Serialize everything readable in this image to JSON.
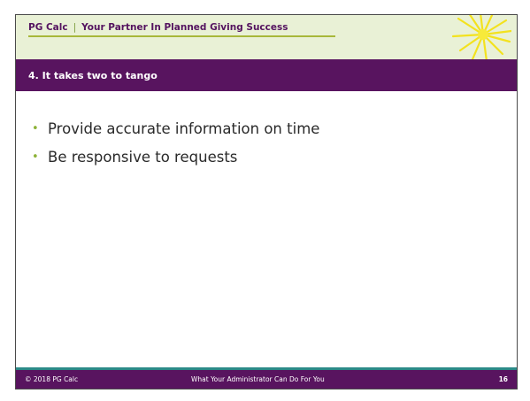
{
  "header": {
    "brand": "PG Calc",
    "separator": "|",
    "tagline": "Your Partner In Planned Giving Success"
  },
  "slide": {
    "title": "4. It takes two to tango",
    "bullets": [
      "Provide accurate information on time",
      "Be responsive to requests"
    ]
  },
  "footer": {
    "copyright": "© 2018 PG Calc",
    "center_text": "What Your Administrator Can Do For You",
    "page_number": "16"
  },
  "colors": {
    "purple": "#58145f",
    "green": "#8db238",
    "burst": "#f3e21e",
    "teal": "#2c8a88"
  }
}
